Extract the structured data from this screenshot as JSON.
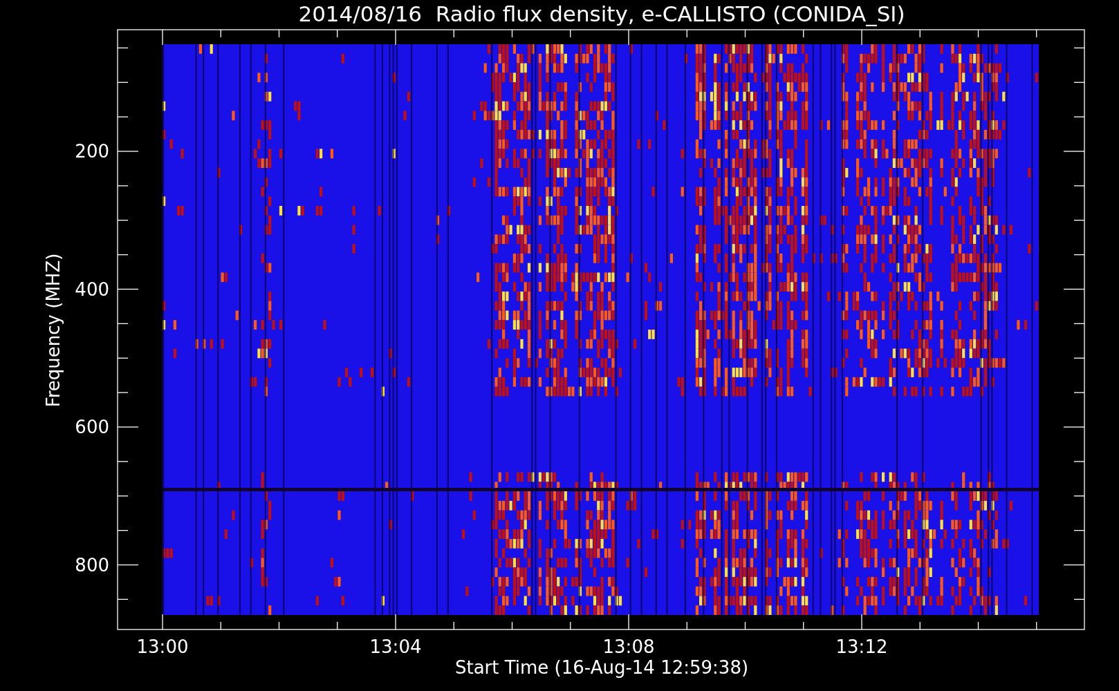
{
  "title": "2014/08/16  Radio flux density, e-CALLISTO (CONIDA_SI)",
  "x_axis": {
    "label": "Start Time (16-Aug-14 12:59:38)",
    "ticks": [
      "13:00",
      "13:04",
      "13:08",
      "13:12"
    ]
  },
  "y_axis": {
    "label": "Frequency (MHZ)",
    "ticks": [
      "200",
      "400",
      "600",
      "800"
    ]
  }
}
